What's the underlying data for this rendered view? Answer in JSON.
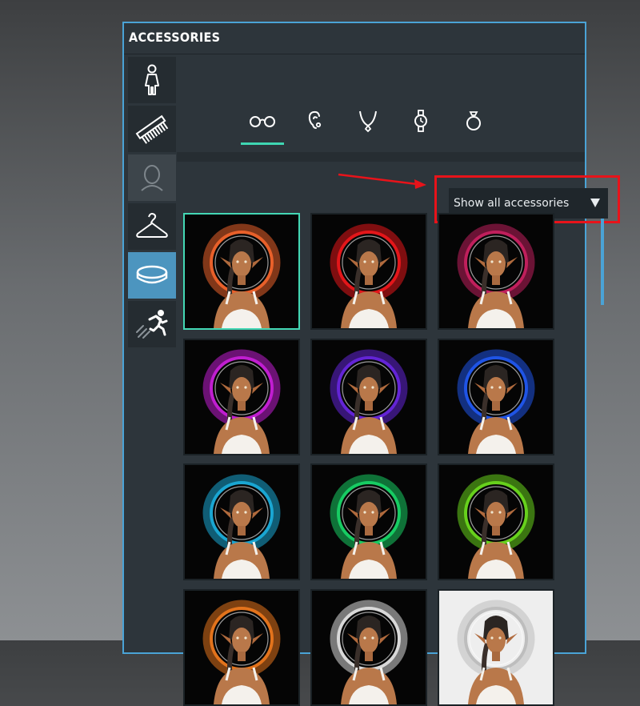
{
  "panel": {
    "title": "ACCESSORIES"
  },
  "sidebar": {
    "items": [
      {
        "name": "body",
        "icon": "person-icon",
        "state": "normal"
      },
      {
        "name": "hair",
        "icon": "comb-icon",
        "state": "normal"
      },
      {
        "name": "head",
        "icon": "head-outline-icon",
        "state": "disabled"
      },
      {
        "name": "clothing",
        "icon": "hanger-icon",
        "state": "normal"
      },
      {
        "name": "accessories",
        "icon": "ring-icon",
        "state": "active"
      },
      {
        "name": "animation",
        "icon": "running-person-icon",
        "state": "normal"
      }
    ]
  },
  "tabs": [
    {
      "icon": "glasses-icon",
      "active": true
    },
    {
      "icon": "ear-icon",
      "active": false
    },
    {
      "icon": "necklace-icon",
      "active": false
    },
    {
      "icon": "watch-icon",
      "active": false
    },
    {
      "icon": "ring-icon",
      "active": false
    }
  ],
  "filter": {
    "selected": "Show all accessories"
  },
  "annotation": {
    "highlight_color": "#e8131a"
  },
  "grid": {
    "thumbnails": [
      {
        "halo_color": "#e8602a",
        "selected": true
      },
      {
        "halo_color": "#e3161a",
        "selected": false
      },
      {
        "halo_color": "#c01f5c",
        "selected": false
      },
      {
        "halo_color": "#c01ed0",
        "selected": false
      },
      {
        "halo_color": "#6324d6",
        "selected": false
      },
      {
        "halo_color": "#1f54e6",
        "selected": false
      },
      {
        "halo_color": "#1aa6d2",
        "selected": false
      },
      {
        "halo_color": "#17cc63",
        "selected": false
      },
      {
        "halo_color": "#67d11c",
        "selected": false
      },
      {
        "halo_color": "#e2731c",
        "selected": false
      },
      {
        "halo_color": "#d9d9d9",
        "selected": false
      },
      {
        "halo_color": "#bdbdbd",
        "selected": false,
        "light_background": true
      }
    ]
  },
  "colors": {
    "accent": "#3fd6b2",
    "panel_border": "#4aa3d6",
    "active_sidebar": "#4c95bf"
  }
}
